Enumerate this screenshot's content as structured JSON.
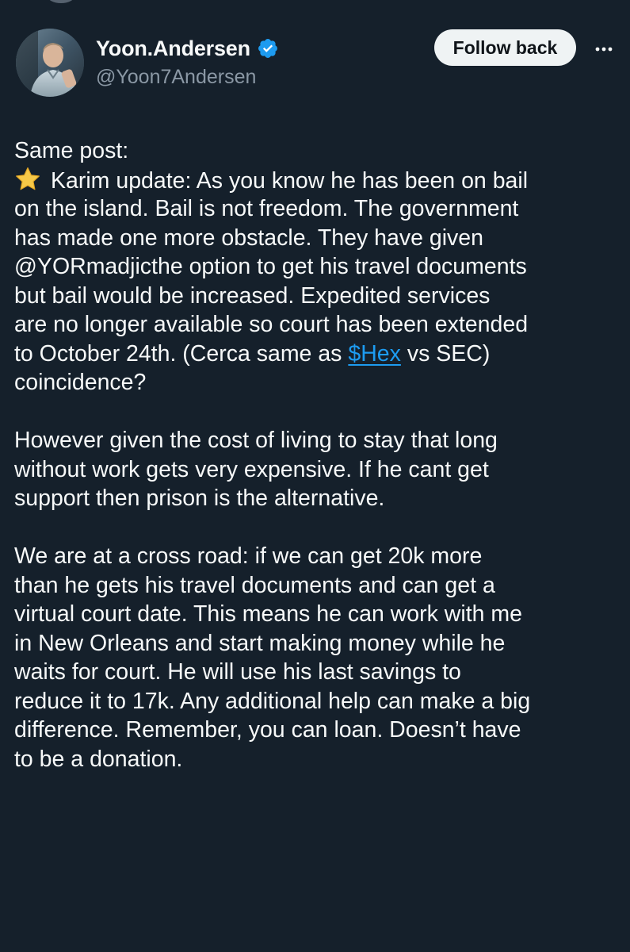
{
  "author": {
    "display_name": "Yoon.Andersen",
    "handle": "@Yoon7Andersen",
    "verified": true
  },
  "actions": {
    "follow_label": "Follow back",
    "more_icon": "more-horizontal-icon"
  },
  "post": {
    "line1": "Same post:",
    "line2_text": "Karim update: As you know he has been on bail",
    "line3": "on the island. Bail is not freedom. The government",
    "line4": "has made one more obstacle. They have given",
    "line5": "@YORmadjicthe option to get his travel documents",
    "line6": "but bail would be increased.   Expedited services",
    "line7": "are no longer available so court has been extended",
    "line8_before": "to October 24th. (Cerca same as ",
    "line8_cashtag": "$Hex",
    "line8_after": " vs SEC)",
    "line9": "coincidence?",
    "line10": "However given the cost of living to stay that long",
    "line11": "without work gets very expensive. If he cant get",
    "line12": "support then prison is the alternative.",
    "line13": "We are at a cross road: if we can get 20k more",
    "line14": "than he gets his travel documents and can get a",
    "line15": "virtual court date. This means he can work with me",
    "line16": "in New Orleans and start making money while he",
    "line17": "waits for court.   He will use his last savings to",
    "line18": "reduce it to 17k. Any additional help can make a big",
    "line19": "difference. Remember, you can loan. Doesn’t have",
    "line20": "to be a donation."
  },
  "colors": {
    "background": "#15202b",
    "text": "#f7f9f9",
    "secondary": "#8b98a5",
    "link": "#1d9bf0",
    "verified_badge": "#1d9bf0"
  }
}
